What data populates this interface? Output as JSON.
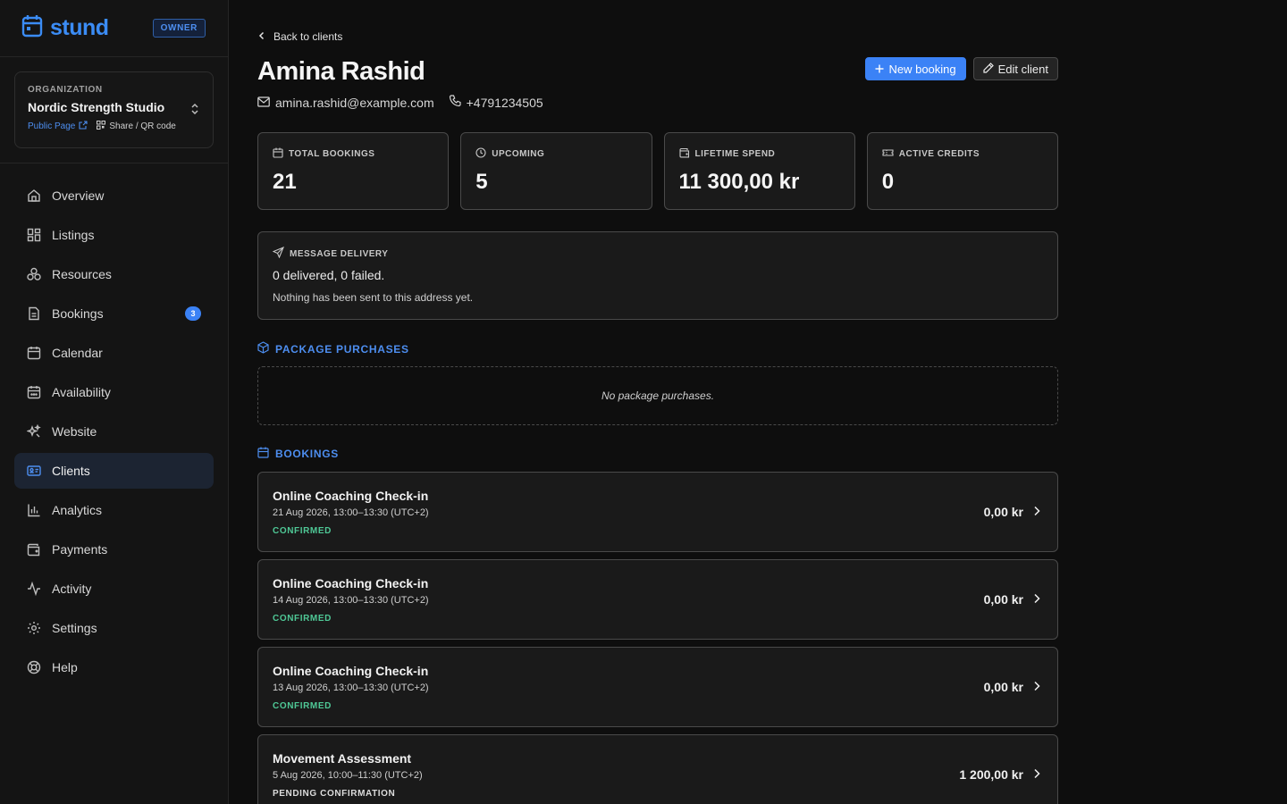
{
  "brand": {
    "name": "stund",
    "role_badge": "OWNER"
  },
  "organization": {
    "caption": "ORGANIZATION",
    "name": "Nordic Strength Studio",
    "public_page_label": "Public Page",
    "share_label": "Share / QR code"
  },
  "nav": {
    "items": [
      {
        "label": "Overview",
        "icon": "home-icon"
      },
      {
        "label": "Listings",
        "icon": "grid-icon"
      },
      {
        "label": "Resources",
        "icon": "resources-icon"
      },
      {
        "label": "Bookings",
        "icon": "file-icon",
        "badge": "3"
      },
      {
        "label": "Calendar",
        "icon": "calendar-icon"
      },
      {
        "label": "Availability",
        "icon": "calendar-check-icon"
      },
      {
        "label": "Website",
        "icon": "sparkles-icon"
      },
      {
        "label": "Clients",
        "icon": "id-card-icon",
        "active": true
      },
      {
        "label": "Analytics",
        "icon": "bar-chart-icon"
      },
      {
        "label": "Payments",
        "icon": "wallet-icon"
      },
      {
        "label": "Activity",
        "icon": "activity-icon"
      },
      {
        "label": "Settings",
        "icon": "gear-icon"
      },
      {
        "label": "Help",
        "icon": "lifebuoy-icon"
      }
    ]
  },
  "client": {
    "back_label": "Back to clients",
    "name": "Amina Rashid",
    "email": "amina.rashid@example.com",
    "phone": "+4791234505",
    "new_booking_label": "New booking",
    "edit_label": "Edit client"
  },
  "stats": [
    {
      "label": "TOTAL BOOKINGS",
      "value": "21",
      "icon": "calendar-icon"
    },
    {
      "label": "UPCOMING",
      "value": "5",
      "icon": "clock-icon"
    },
    {
      "label": "LIFETIME SPEND",
      "value": "11 300,00 kr",
      "icon": "wallet-icon"
    },
    {
      "label": "ACTIVE CREDITS",
      "value": "0",
      "icon": "ticket-icon"
    }
  ],
  "delivery": {
    "title": "MESSAGE DELIVERY",
    "summary": "0 delivered, 0 failed.",
    "note": "Nothing has been sent to this address yet."
  },
  "packages": {
    "title": "PACKAGE PURCHASES",
    "empty": "No package purchases."
  },
  "bookings": {
    "title": "BOOKINGS",
    "items": [
      {
        "title": "Online Coaching Check-in",
        "date": "21 Aug 2026, 13:00–13:30 (UTC+2)",
        "status": "CONFIRMED",
        "price": "0,00 kr"
      },
      {
        "title": "Online Coaching Check-in",
        "date": "14 Aug 2026, 13:00–13:30 (UTC+2)",
        "status": "CONFIRMED",
        "price": "0,00 kr"
      },
      {
        "title": "Online Coaching Check-in",
        "date": "13 Aug 2026, 13:00–13:30 (UTC+2)",
        "status": "CONFIRMED",
        "price": "0,00 kr"
      },
      {
        "title": "Movement Assessment",
        "date": "5 Aug 2026, 10:00–11:30 (UTC+2)",
        "status": "PENDING CONFIRMATION",
        "price": "1 200,00 kr"
      }
    ]
  }
}
